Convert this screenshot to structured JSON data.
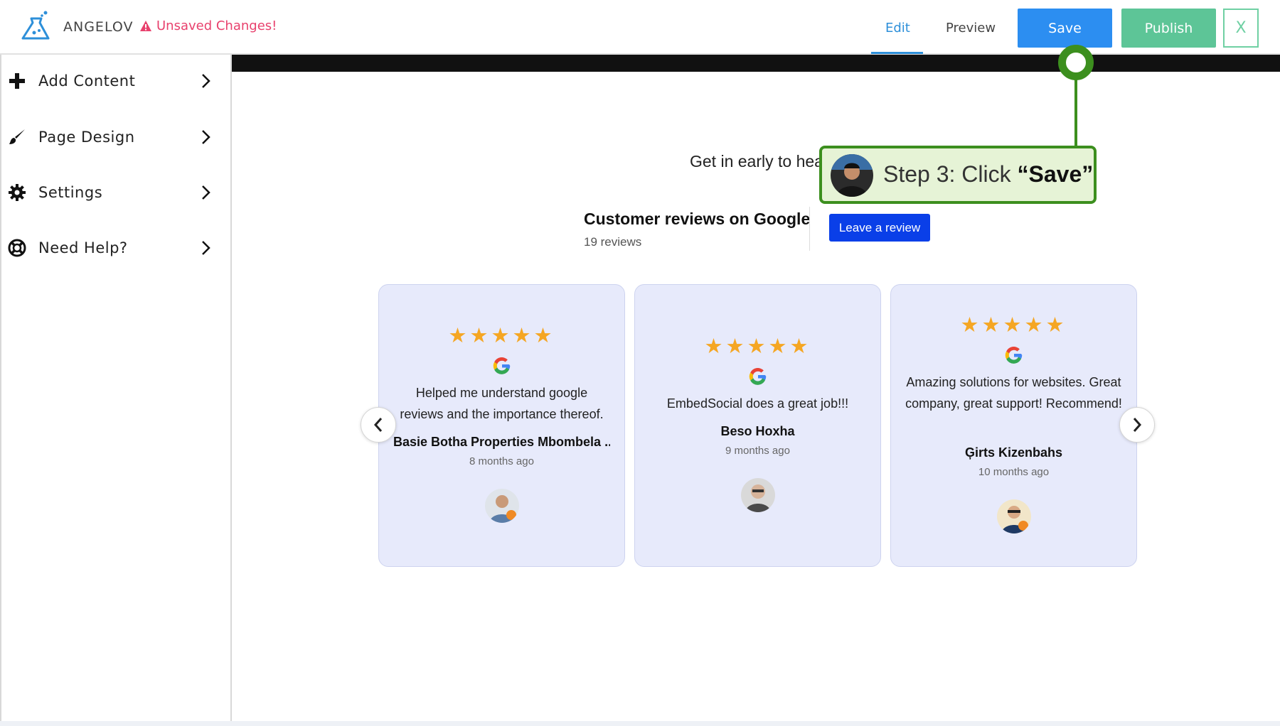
{
  "header": {
    "brand": "ANGELOV",
    "unsaved": "Unsaved Changes!",
    "tabs": {
      "edit": "Edit",
      "preview": "Preview"
    },
    "save_label": "Save",
    "publish_label": "Publish",
    "close_label": "X",
    "icons": {
      "logo": "flask-icon",
      "warning": "warning-triangle-icon"
    },
    "colors": {
      "accent": "#2c8ef1",
      "publish": "#5dc597",
      "warning": "#e8416d"
    }
  },
  "sidebar": {
    "items": [
      {
        "label": "Add Content",
        "icon": "plus-icon"
      },
      {
        "label": "Page Design",
        "icon": "paintbrush-icon"
      },
      {
        "label": "Settings",
        "icon": "gear-icon"
      },
      {
        "label": "Need Help?",
        "icon": "lifebuoy-icon"
      }
    ]
  },
  "canvas": {
    "intro_text": "Get in early to hea",
    "reviews": {
      "title": "Customer reviews on Google",
      "count": "19 reviews",
      "leave_review": "Leave a review",
      "cards": [
        {
          "stars": "★★★★★",
          "text": "Helped me understand google reviews and the importance thereof.",
          "author": "Basie Botha Properties Mbombela ...",
          "time": "8 months ago"
        },
        {
          "stars": "★★★★★",
          "text": "EmbedSocial does a great job!!!",
          "author": "Beso Hoxha",
          "time": "9 months ago"
        },
        {
          "stars": "★★★★★",
          "text": "Amazing solutions for websites. Great company, great support! Recommend!",
          "author": "Ģirts Kizenbahs",
          "time": "10 months ago"
        }
      ],
      "colors": {
        "card_bg": "#e7eafb",
        "star": "#f5a623",
        "button": "#0a3fe8"
      }
    }
  },
  "tooltip": {
    "prefix": "Step 3: Click ",
    "emphasis": "“Save”",
    "color": "#3c8f1e"
  }
}
